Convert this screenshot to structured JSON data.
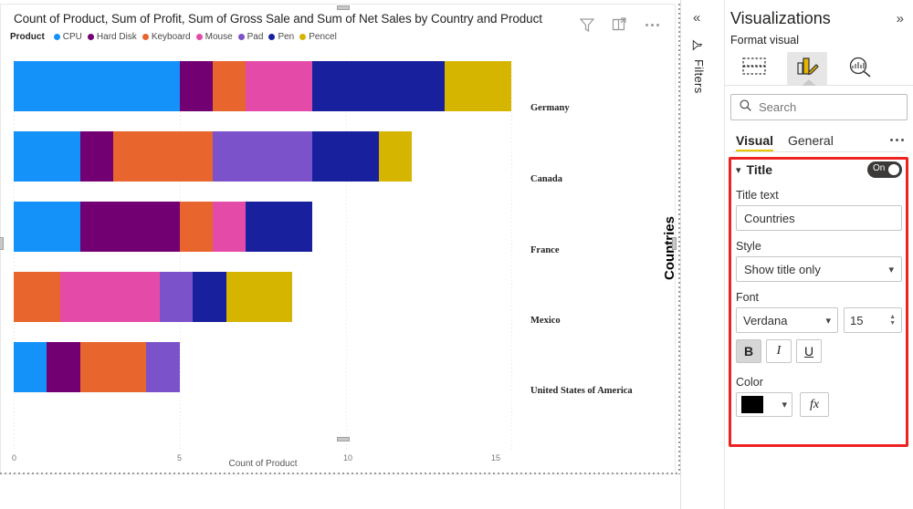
{
  "chart": {
    "title": "Count of Product, Sum of Profit, Sum of Gross Sale and Sum of Net Sales by Country and Product",
    "tools": {
      "filter": "filter-icon",
      "focus": "focus-mode-icon",
      "more": "more-options-icon"
    }
  },
  "chart_data": {
    "type": "bar",
    "orientation": "horizontal",
    "stacked": true,
    "title": "Count of Product, Sum of Profit, Sum of Gross Sale and Sum of Net Sales by Country and Product",
    "xlabel": "Count of Product",
    "ylabel": "Countries",
    "legend_title": "Product",
    "legend_position": "top",
    "grid": true,
    "xlim": [
      0,
      15
    ],
    "xticks": [
      "0",
      "5",
      "10",
      "15"
    ],
    "categories": [
      "Germany",
      "Canada",
      "France",
      "Mexico",
      "United States of America"
    ],
    "series": [
      {
        "name": "CPU",
        "color": "#1492FA",
        "values": [
          5,
          2,
          2,
          0,
          1
        ]
      },
      {
        "name": "Hard Disk",
        "color": "#730073",
        "values": [
          1,
          1,
          3,
          0,
          1
        ]
      },
      {
        "name": "Keyboard",
        "color": "#E8662D",
        "values": [
          1,
          3,
          1,
          1.4,
          2
        ]
      },
      {
        "name": "Mouse",
        "color": "#E44BA8",
        "values": [
          2,
          0,
          1,
          3,
          0
        ]
      },
      {
        "name": "Pad",
        "color": "#7B52C9",
        "values": [
          0,
          3,
          0,
          1,
          1
        ]
      },
      {
        "name": "Pen",
        "color": "#19209E",
        "values": [
          4,
          2,
          2,
          1,
          0
        ]
      },
      {
        "name": "Pencel",
        "color": "#D6B500",
        "values": [
          2,
          1,
          0,
          2,
          0
        ]
      }
    ]
  },
  "rail": {
    "collapse_icon": "collapse-panel-icon",
    "filters_label": "Filters",
    "filters_icon": "filter-icon"
  },
  "panel": {
    "title": "Visualizations",
    "expand_icon": "expand-panel-icon",
    "format_visual_label": "Format visual",
    "tabs": [
      {
        "name": "build-visual-tab",
        "icon": "table-fields-icon",
        "active": false
      },
      {
        "name": "format-visual-tab",
        "icon": "paint-brush-icon",
        "active": true
      },
      {
        "name": "analytics-tab",
        "icon": "magnifier-chart-icon",
        "active": false
      }
    ],
    "search": {
      "placeholder": "Search",
      "value": "",
      "icon": "search-icon"
    },
    "subtabs": [
      {
        "label": "Visual",
        "active": true
      },
      {
        "label": "General",
        "active": false
      }
    ],
    "subtabs_more": "more-options-icon",
    "title_section": {
      "header": "Title",
      "toggle_state": "On",
      "title_text_label": "Title text",
      "title_text_value": "Countries",
      "style_label": "Style",
      "style_value": "Show title only",
      "font_label": "Font",
      "font_family": "Verdana",
      "font_size": "15",
      "bold_label": "B",
      "italic_label": "I",
      "underline_label": "U",
      "bold_active": true
    },
    "color_section": {
      "label": "Color",
      "value": "#000000",
      "fx_label": "fx"
    }
  }
}
